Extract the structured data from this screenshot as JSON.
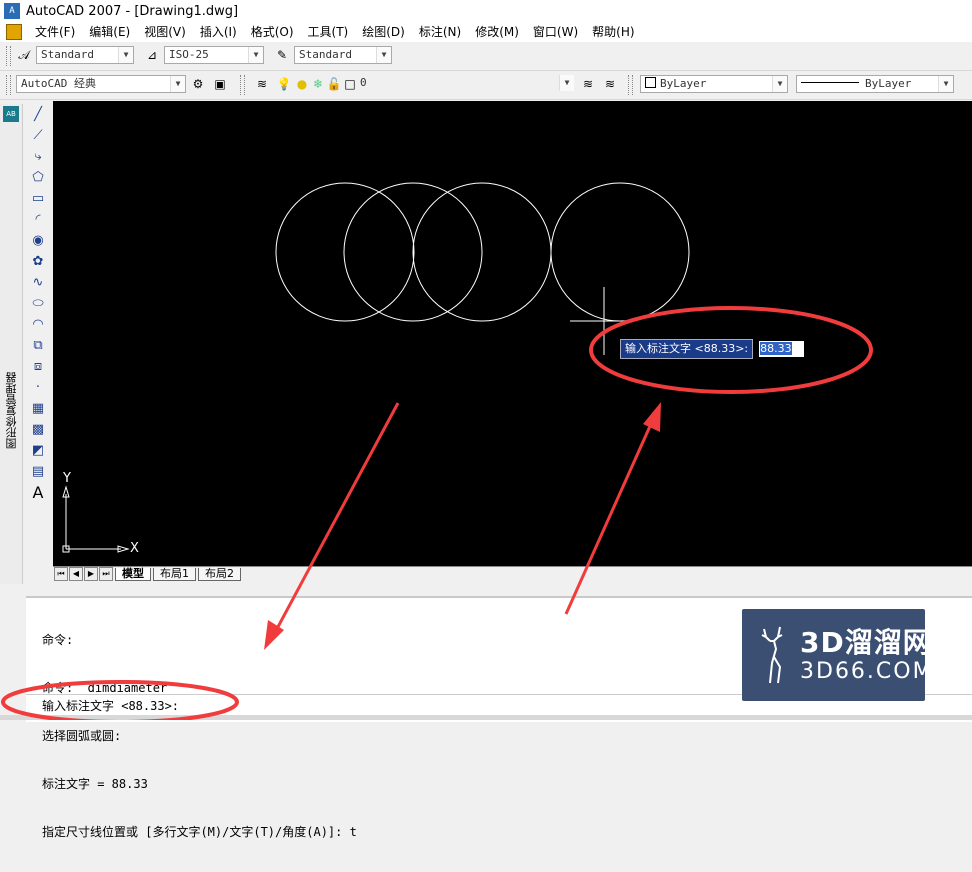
{
  "window": {
    "title": "AutoCAD 2007 - [Drawing1.dwg]",
    "app_icon_text": "A"
  },
  "menu": [
    "文件(F)",
    "编辑(E)",
    "视图(V)",
    "插入(I)",
    "格式(O)",
    "工具(T)",
    "绘图(D)",
    "标注(N)",
    "修改(M)",
    "窗口(W)",
    "帮助(H)"
  ],
  "styles_toolbar": {
    "text_style": "Standard",
    "dim_style": "ISO-25",
    "table_style": "Standard"
  },
  "workspace_toolbar": {
    "workspace": "AutoCAD 经典",
    "layer": "0",
    "color": "ByLayer",
    "linetype": "ByLayer"
  },
  "draw_tools": [
    "line-icon",
    "construction-line-icon",
    "polyline-icon",
    "polygon-icon",
    "rectangle-icon",
    "arc-icon",
    "circle-icon",
    "revision-cloud-icon",
    "spline-icon",
    "ellipse-icon",
    "ellipse-arc-icon",
    "insert-block-icon",
    "make-block-icon",
    "point-icon",
    "hatch-icon",
    "gradient-icon",
    "region-icon",
    "table-icon",
    "multiline-text-icon"
  ],
  "palette": {
    "label": "图形修复管理器",
    "icon_text": "AB"
  },
  "canvas": {
    "background": "#000000",
    "ucs_labels": {
      "x": "X",
      "y": "Y"
    },
    "dynamic_input": {
      "prompt": "输入标注文字 <88.33>:",
      "value": "88.33"
    }
  },
  "layout_tabs": [
    "模型",
    "布局1",
    "布局2"
  ],
  "command_history": [
    "命令:",
    "命令: _dimdiameter",
    "选择圆弧或圆:",
    "标注文字 = 88.33",
    "指定尺寸线位置或 [多行文字(M)/文字(T)/角度(A)]: t"
  ],
  "command_line": "输入标注文字 <88.33>:",
  "watermark": {
    "text1": "3D溜溜网",
    "text2": "3D66.COM"
  },
  "annotation_color": "#f03c3c"
}
